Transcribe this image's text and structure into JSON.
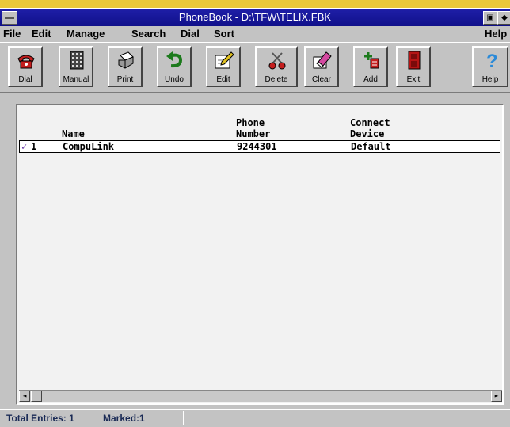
{
  "window": {
    "title": "PhoneBook - D:\\TFW\\TELIX.FBK"
  },
  "titlebar": {
    "right_controls": [
      "▣",
      "◆"
    ]
  },
  "menu": {
    "items": [
      {
        "label": "File"
      },
      {
        "label": "Edit"
      },
      {
        "label": "Manage"
      },
      {
        "label": "Search"
      },
      {
        "label": "Dial"
      },
      {
        "label": "Sort"
      }
    ],
    "help": "Help"
  },
  "toolbar": {
    "buttons": [
      {
        "label": "Dial",
        "icon": "telephone-icon"
      },
      {
        "label": "Manual",
        "icon": "keypad-icon"
      },
      {
        "label": "Print",
        "icon": "printer-icon"
      },
      {
        "label": "Undo",
        "icon": "undo-arrow-icon"
      },
      {
        "label": "Edit",
        "icon": "pencil-pad-icon"
      },
      {
        "label": "Delete",
        "icon": "scissors-icon"
      },
      {
        "label": "Clear",
        "icon": "eraser-icon"
      },
      {
        "label": "Add",
        "icon": "add-plus-icon"
      },
      {
        "label": "Exit",
        "icon": "exit-door-icon"
      },
      {
        "label": "Help",
        "icon": "question-mark-icon"
      }
    ]
  },
  "list": {
    "columns": {
      "name": "Name",
      "phone_line1": "Phone",
      "phone_line2": "Number",
      "device_line1": "Connect",
      "device_line2": "Device"
    },
    "rows": [
      {
        "marker": "✓",
        "index": "1",
        "name": "CompuLink",
        "phone": "9244301",
        "device": "Default"
      }
    ]
  },
  "status": {
    "total_entries": "Total Entries: 1",
    "marked": "Marked:1"
  },
  "colors": {
    "titlebar": "#10108a",
    "window_face": "#c3c3c3",
    "background": "#e9c83a"
  }
}
